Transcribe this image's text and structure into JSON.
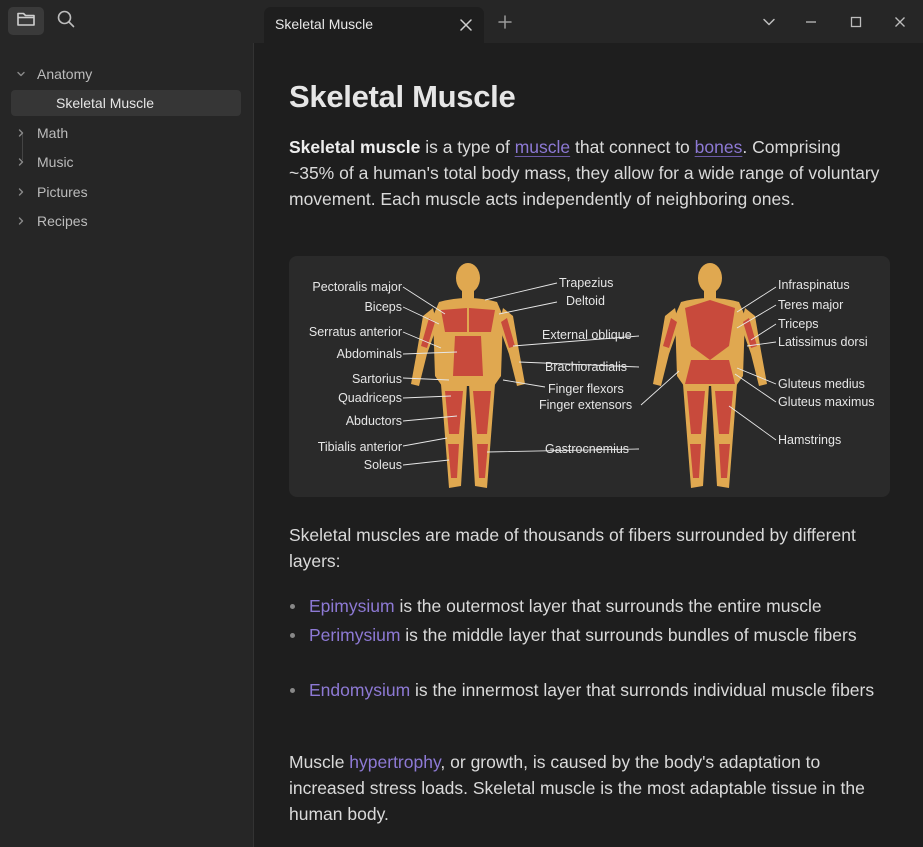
{
  "tab": {
    "title": "Skeletal Muscle"
  },
  "sidebar": {
    "items": [
      {
        "label": "Anatomy"
      },
      {
        "label": "Skeletal Muscle"
      },
      {
        "label": "Math"
      },
      {
        "label": "Music"
      },
      {
        "label": "Pictures"
      },
      {
        "label": "Recipes"
      }
    ]
  },
  "note": {
    "title": "Skeletal Muscle",
    "intro": {
      "bold": "Skeletal muscle",
      "t1": " is a type of ",
      "link1": "muscle",
      "t2": " that connect to ",
      "link2": "bones",
      "t3": ". Comprising ~35% of a human's total body mass, they allow for a wide range of voluntary movement. Each muscle acts independently of neighboring ones."
    },
    "figure_labels": {
      "left": [
        "Pectoralis major",
        "Biceps",
        "Serratus anterior",
        "Abdominals",
        "Sartorius",
        "Quadriceps",
        "Abductors",
        "Tibialis anterior",
        "Soleus"
      ],
      "middle": [
        "Trapezius",
        "Deltoid",
        "External oblique",
        "Brachioradialis",
        "Finger flexors",
        "Finger extensors",
        "Gastrocnemius"
      ],
      "right": [
        "Infraspinatus",
        "Teres major",
        "Triceps",
        "Latissimus dorsi",
        "Gluteus medius",
        "Gluteus maximus",
        "Hamstrings"
      ]
    },
    "layers_intro": "Skeletal muscles are made of thousands of fibers surrounded by different layers:",
    "layers": [
      {
        "term": "Epimysium",
        "text": " is the outermost layer that surrounds the entire muscle"
      },
      {
        "term": "Perimysium",
        "text": " is the middle layer that surrounds bundles of muscle fibers"
      },
      {
        "term": "Endomysium",
        "text": " is the innermost layer that surronds individual muscle fibers"
      }
    ],
    "hyper": {
      "t1": "Muscle ",
      "link": "hypertrophy",
      "t2": ", or growth, is caused by the body's adaptation to increased stress loads. Skeletal muscle is the most adaptable tissue in the human body."
    }
  },
  "icons": {
    "files": "folder-icon",
    "search": "search-icon",
    "close": "close-icon",
    "new_tab": "plus-icon",
    "menu": "chevron-down-icon",
    "minimize": "minimize-icon",
    "maximize": "maximize-icon",
    "win_close": "window-close-icon"
  },
  "colors": {
    "accent": "#8d79d4",
    "skin": "#e0a850",
    "muscle": "#c84a3c",
    "background": "#1e1e1e",
    "sidebar": "#262626"
  }
}
